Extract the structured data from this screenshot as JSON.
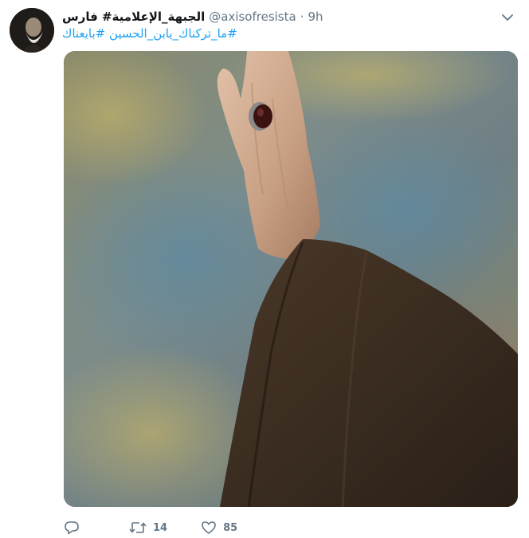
{
  "tweet": {
    "display_name": "الجبهة_الإعلامية# فارس",
    "handle": "@axisofresista",
    "separator": "·",
    "time": "9h",
    "hashtags": [
      "#ما_تركناك_يابن_الحسين",
      "#بايعناك"
    ],
    "image_description_icon": "photo",
    "actions": {
      "reply_icon": "reply-icon",
      "retweet_icon": "retweet-icon",
      "retweet_count": "14",
      "like_icon": "heart-icon",
      "like_count": "85"
    }
  },
  "colors": {
    "link": "#1da1f2",
    "muted": "#657786",
    "text": "#14171a"
  }
}
